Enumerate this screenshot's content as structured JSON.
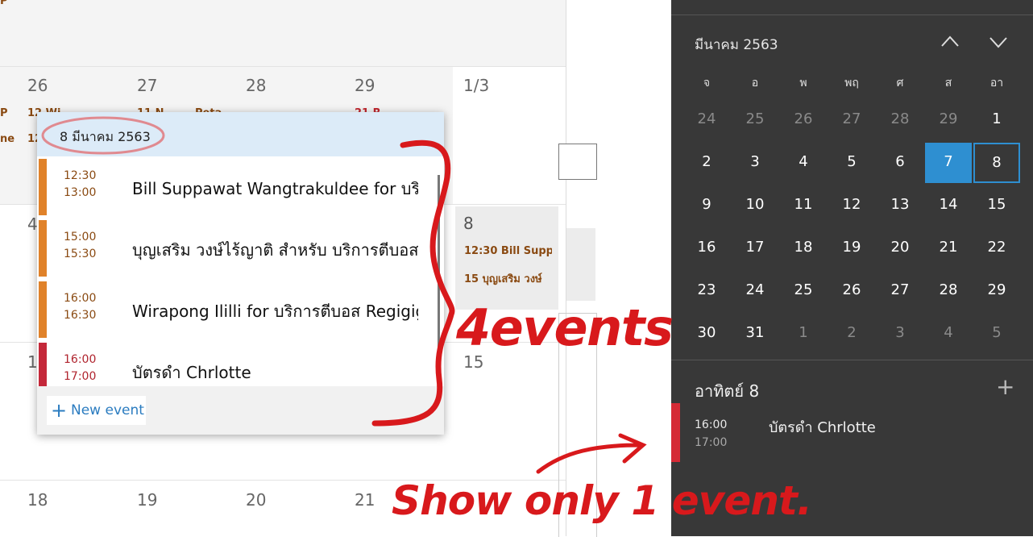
{
  "calendar": {
    "top_fragment": "P",
    "week_row_1": [
      "26",
      "27",
      "28",
      "29",
      "1/3"
    ],
    "row1_fragments": {
      "a": "P",
      "b": "ne",
      "c": "12",
      "d": "12 Wi",
      "e": "11 N",
      "f": "Peta",
      "g": "21 R"
    },
    "week_row_2": [
      "4",
      "8"
    ],
    "week_row_3": [
      "11",
      "15"
    ],
    "week_row_4": [
      "18",
      "19",
      "20",
      "21"
    ],
    "day8_events": [
      "12:30 Bill Suppa",
      "15 บุญเสริม วงษ์"
    ]
  },
  "popup": {
    "date": "8 มีนาคม 2563",
    "events": [
      {
        "start": "12:30",
        "end": "13:00",
        "title": "Bill Suppawat Wangtrakuldee for บริ",
        "color": "#e0822a"
      },
      {
        "start": "15:00",
        "end": "15:30",
        "title": "บุญเสริม วงษ์ไร้ญาติ สำหรับ บริการตีบอส Re",
        "color": "#e0822a"
      },
      {
        "start": "16:00",
        "end": "16:30",
        "title": "Wirapong Ililli for บริการตีบอส Regigig",
        "color": "#e0822a"
      },
      {
        "start": "16:00",
        "end": "17:00",
        "title": "บัตรดำ Chrlotte",
        "color": "#c4283a"
      }
    ],
    "new_event_label": "New event"
  },
  "side": {
    "month_label": "มีนาคม 2563",
    "weekdays": [
      "จ",
      "อ",
      "พ",
      "พฤ",
      "ศ",
      "ส",
      "อา"
    ],
    "weeks": [
      [
        "24",
        "25",
        "26",
        "27",
        "28",
        "29",
        "1"
      ],
      [
        "2",
        "3",
        "4",
        "5",
        "6",
        "7",
        "8"
      ],
      [
        "9",
        "10",
        "11",
        "12",
        "13",
        "14",
        "15"
      ],
      [
        "16",
        "17",
        "18",
        "19",
        "20",
        "21",
        "22"
      ],
      [
        "23",
        "24",
        "25",
        "26",
        "27",
        "28",
        "29"
      ],
      [
        "30",
        "31",
        "1",
        "2",
        "3",
        "4",
        "5"
      ]
    ],
    "selected_day": "7",
    "focused_day": "8",
    "agenda_title": "อาทิตย์ 8",
    "agenda_event": {
      "start": "16:00",
      "end": "17:00",
      "title": "บัตรดำ Chrlotte"
    }
  },
  "annotations": {
    "note_1": "4events",
    "note_2": "Show only 1 event."
  },
  "colors": {
    "accent": "#2e8fd1",
    "event_orange": "#e0822a",
    "event_red": "#c4283a",
    "ink": "#d8191c",
    "panel": "#383838"
  }
}
